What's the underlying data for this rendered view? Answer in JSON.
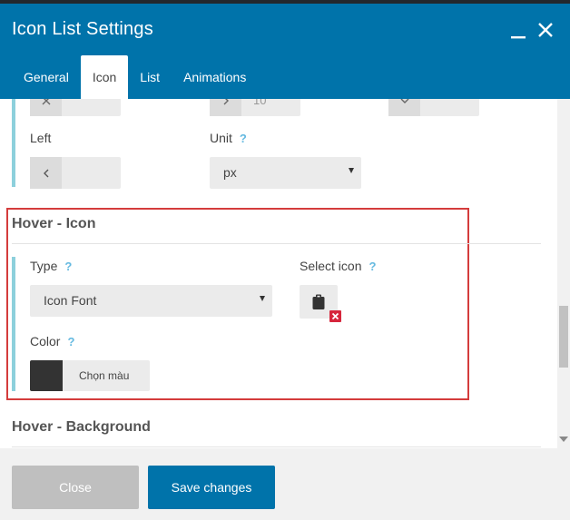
{
  "header": {
    "title": "Icon List Settings",
    "minimize_icon": "minimize-icon",
    "close_icon": "close-icon",
    "tabs": [
      {
        "label": "General",
        "active": false
      },
      {
        "label": "Icon",
        "active": true
      },
      {
        "label": "List",
        "active": false
      },
      {
        "label": "Animations",
        "active": false
      }
    ]
  },
  "top_row": {
    "field2_value": "10"
  },
  "margin": {
    "left_label": "Left",
    "left_value": "",
    "unit_label": "Unit",
    "unit_value": "px"
  },
  "hover_icon": {
    "title": "Hover - Icon",
    "type_label": "Type",
    "type_value": "Icon Font",
    "select_icon_label": "Select icon",
    "selected_icon": "clipboard-icon",
    "color_label": "Color",
    "color_value": "#333333",
    "color_button_label": "Chọn màu"
  },
  "hover_background": {
    "title": "Hover - Background"
  },
  "help_glyph": "?",
  "footer": {
    "close_label": "Close",
    "save_label": "Save changes"
  },
  "colors": {
    "primary": "#0073aa",
    "accent_bar": "#8dd0dc",
    "highlight_box": "#d43c3c",
    "remove_badge": "#d6263c"
  }
}
